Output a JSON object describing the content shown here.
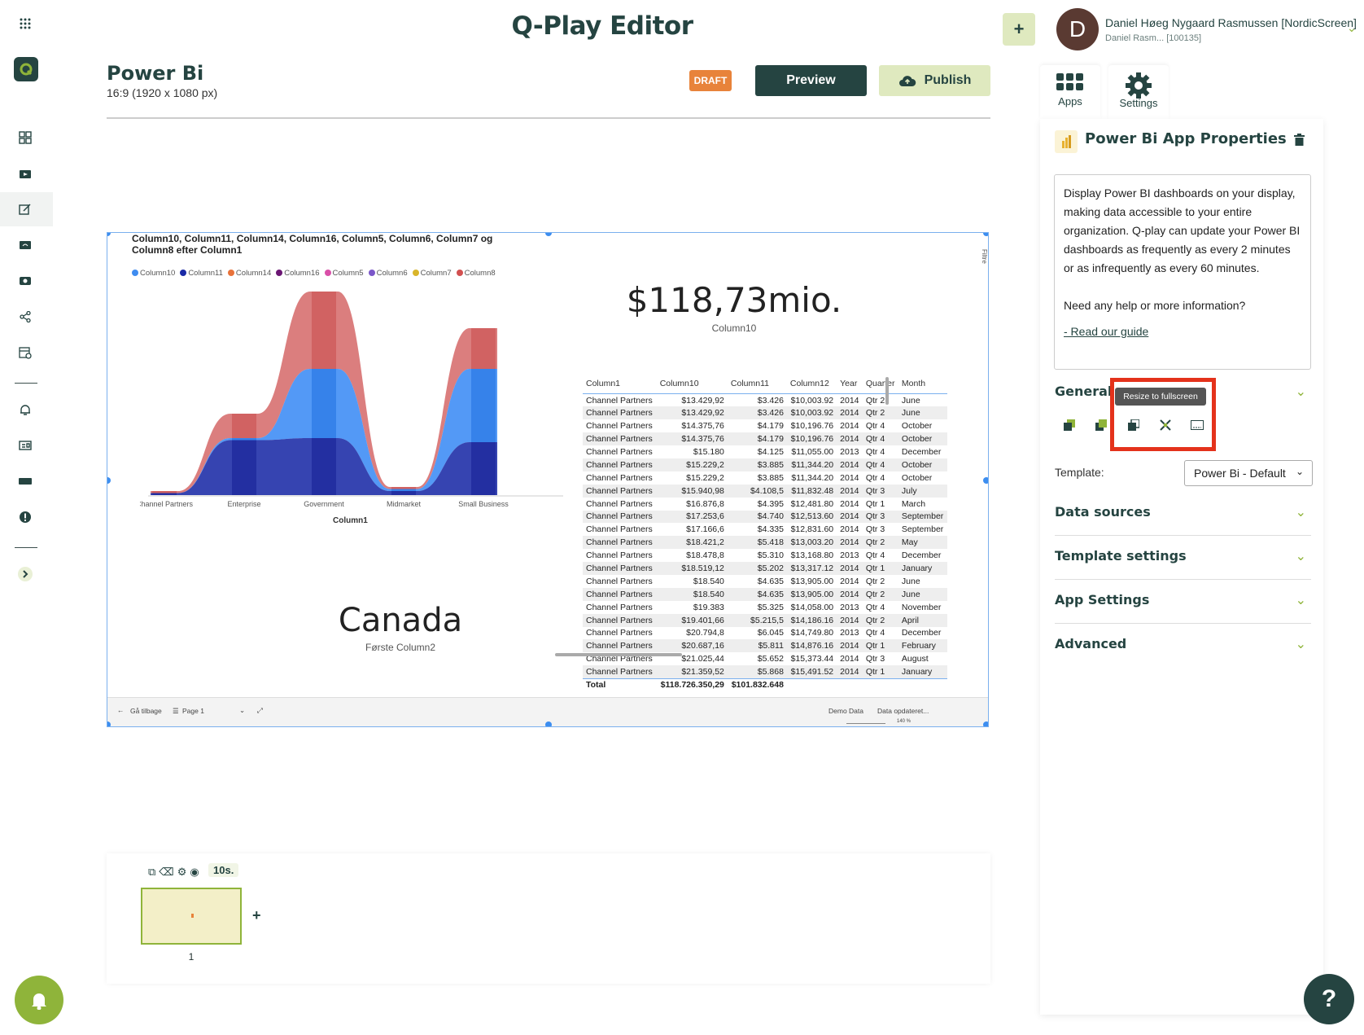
{
  "app": {
    "title": "Q-Play Editor",
    "add_label": "+",
    "user": {
      "initial": "D",
      "name": "Daniel Høeg Nygaard Rasmussen [NordicScreen]",
      "sub": "Daniel Rasm... [100135]"
    }
  },
  "page": {
    "title": "Power Bi",
    "size": "16:9 (1920 x 1080 px)",
    "draft_label": "DRAFT",
    "preview_label": "Preview",
    "publish_label": "Publish"
  },
  "report": {
    "chart_title": "Column10, Column11, Column14, Column16, Column5, Column6, Column7 og Column8 efter Column1",
    "kpi_value": "$118,73mio.",
    "kpi_label": "Column10",
    "card_value": "Canada",
    "card_label": "Første Column2",
    "filters_label": "Filtre",
    "footer": {
      "back": "Gå tilbage",
      "page": "Page 1",
      "demo": "Demo Data",
      "updated": "Data opdateret...",
      "zoom": "140 %"
    },
    "table": {
      "headers": [
        "Column1",
        "Column10",
        "Column11",
        "Column12",
        "Year",
        "Quarter",
        "Month"
      ],
      "rows": [
        [
          "Channel Partners",
          "$13.429,92",
          "$3.426",
          "$10,003.92",
          "2014",
          "Qtr 2",
          "June"
        ],
        [
          "Channel Partners",
          "$13.429,92",
          "$3.426",
          "$10,003.92",
          "2014",
          "Qtr 2",
          "June"
        ],
        [
          "Channel Partners",
          "$14.375,76",
          "$4.179",
          "$10,196.76",
          "2014",
          "Qtr 4",
          "October"
        ],
        [
          "Channel Partners",
          "$14.375,76",
          "$4.179",
          "$10,196.76",
          "2014",
          "Qtr 4",
          "October"
        ],
        [
          "Channel Partners",
          "$15.180",
          "$4.125",
          "$11,055.00",
          "2013",
          "Qtr 4",
          "December"
        ],
        [
          "Channel Partners",
          "$15.229,2",
          "$3.885",
          "$11,344.20",
          "2014",
          "Qtr 4",
          "October"
        ],
        [
          "Channel Partners",
          "$15.229,2",
          "$3.885",
          "$11,344.20",
          "2014",
          "Qtr 4",
          "October"
        ],
        [
          "Channel Partners",
          "$15.940,98",
          "$4.108,5",
          "$11,832.48",
          "2014",
          "Qtr 3",
          "July"
        ],
        [
          "Channel Partners",
          "$16.876,8",
          "$4.395",
          "$12,481.80",
          "2014",
          "Qtr 1",
          "March"
        ],
        [
          "Channel Partners",
          "$17.253,6",
          "$4.740",
          "$12,513.60",
          "2014",
          "Qtr 3",
          "September"
        ],
        [
          "Channel Partners",
          "$17.166,6",
          "$4.335",
          "$12,831.60",
          "2014",
          "Qtr 3",
          "September"
        ],
        [
          "Channel Partners",
          "$18.421,2",
          "$5.418",
          "$13,003.20",
          "2014",
          "Qtr 2",
          "May"
        ],
        [
          "Channel Partners",
          "$18.478,8",
          "$5.310",
          "$13,168.80",
          "2013",
          "Qtr 4",
          "December"
        ],
        [
          "Channel Partners",
          "$18.519,12",
          "$5.202",
          "$13,317.12",
          "2014",
          "Qtr 1",
          "January"
        ],
        [
          "Channel Partners",
          "$18.540",
          "$4.635",
          "$13,905.00",
          "2014",
          "Qtr 2",
          "June"
        ],
        [
          "Channel Partners",
          "$18.540",
          "$4.635",
          "$13,905.00",
          "2014",
          "Qtr 2",
          "June"
        ],
        [
          "Channel Partners",
          "$19.383",
          "$5.325",
          "$14,058.00",
          "2013",
          "Qtr 4",
          "November"
        ],
        [
          "Channel Partners",
          "$19.401,66",
          "$5.215,5",
          "$14,186.16",
          "2014",
          "Qtr 2",
          "April"
        ],
        [
          "Channel Partners",
          "$20.794,8",
          "$6.045",
          "$14,749.80",
          "2013",
          "Qtr 4",
          "December"
        ],
        [
          "Channel Partners",
          "$20.687,16",
          "$5.811",
          "$14,876.16",
          "2014",
          "Qtr 1",
          "February"
        ],
        [
          "Channel Partners",
          "$21.025,44",
          "$5.652",
          "$15,373.44",
          "2014",
          "Qtr 3",
          "August"
        ],
        [
          "Channel Partners",
          "$21.359,52",
          "$5.868",
          "$15,491.52",
          "2014",
          "Qtr 1",
          "January"
        ]
      ],
      "total": [
        "Total",
        "$118.726.350,29",
        "$101.832.648",
        "",
        "",
        "",
        ""
      ]
    },
    "legend": [
      {
        "name": "Column10",
        "color": "#3f8cf0"
      },
      {
        "name": "Column11",
        "color": "#1a2aa6"
      },
      {
        "name": "Column14",
        "color": "#e8723a"
      },
      {
        "name": "Column16",
        "color": "#6b1673"
      },
      {
        "name": "Column5",
        "color": "#d94fa8"
      },
      {
        "name": "Column6",
        "color": "#7b57c9"
      },
      {
        "name": "Column7",
        "color": "#d9b52b"
      },
      {
        "name": "Column8",
        "color": "#d25050"
      }
    ]
  },
  "chart_data": {
    "type": "area",
    "title": "Column10, Column11, Column14, Column16, Column5, Column6, Column7 og Column8 efter Column1",
    "xlabel": "Column1",
    "categories": [
      "Channel Partners",
      "Enterprise",
      "Government",
      "Midmarket",
      "Small Business"
    ],
    "series": [
      {
        "name": "Column8",
        "values": [
          2,
          40,
          100,
          4,
          82
        ]
      },
      {
        "name": "Column10",
        "values": [
          1,
          28,
          62,
          3,
          62
        ]
      },
      {
        "name": "Column11",
        "values": [
          1,
          27,
          28,
          2,
          26
        ]
      }
    ]
  },
  "thumbnails": {
    "duration": "10s.",
    "items": [
      {
        "number": "1"
      }
    ],
    "add_label": "+"
  },
  "panel": {
    "tabs": [
      {
        "label": "Apps",
        "icon": "apps-grid-icon"
      },
      {
        "label": "Settings",
        "icon": "gear-icon"
      }
    ],
    "title": "Power Bi App Properties",
    "description": "Display Power BI dashboards on your display, making data accessible to your entire organization. Q-play can update your Power BI dashboards as frequently as every 2 minutes or as infrequently as every 60 minutes.",
    "help_text": "Need any help or more information?",
    "guide_link": "- Read our guide",
    "general_label": "General",
    "tooltip": "Resize to fullscreen",
    "template_label": "Template:",
    "template_value": "Power Bi - Default",
    "sections": [
      "Data sources",
      "Template settings",
      "App Settings",
      "Advanced"
    ]
  },
  "help_label": "?"
}
